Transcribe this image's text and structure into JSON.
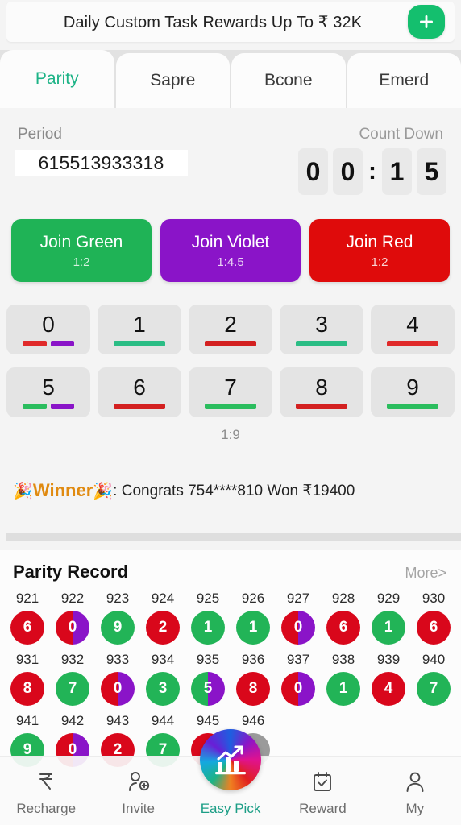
{
  "promo": {
    "text": "Daily Custom Task Rewards Up To ₹ 32K",
    "add_button_icon": "plus-icon"
  },
  "tabs": [
    {
      "label": "Parity",
      "active": true
    },
    {
      "label": "Sapre",
      "active": false
    },
    {
      "label": "Bcone",
      "active": false
    },
    {
      "label": "Emerd",
      "active": false
    }
  ],
  "game": {
    "period_label": "Period",
    "period_value": "615513933318",
    "countdown_label": "Count Down",
    "countdown": {
      "d1": "0",
      "d2": "0",
      "colon": ":",
      "d3": "1",
      "d4": "5"
    },
    "join_buttons": [
      {
        "title": "Join Green",
        "ratio": "1:2",
        "color": "#1fb356"
      },
      {
        "title": "Join Violet",
        "ratio": "1:4.5",
        "color": "#8a14c8"
      },
      {
        "title": "Join Red",
        "ratio": "1:2",
        "color": "#df0b0b"
      }
    ],
    "numbers_row1": [
      {
        "digit": "0",
        "colors": [
          "#e02a2a",
          "#8a14c8"
        ]
      },
      {
        "digit": "1",
        "colors": [
          "#2bbd85"
        ]
      },
      {
        "digit": "2",
        "colors": [
          "#d32020"
        ]
      },
      {
        "digit": "3",
        "colors": [
          "#2bbd85"
        ]
      },
      {
        "digit": "4",
        "colors": [
          "#e02a2a"
        ]
      }
    ],
    "numbers_row2": [
      {
        "digit": "5",
        "colors": [
          "#2bbd5e",
          "#8a14c8"
        ]
      },
      {
        "digit": "6",
        "colors": [
          "#d32020"
        ]
      },
      {
        "digit": "7",
        "colors": [
          "#2bbd5e"
        ]
      },
      {
        "digit": "8",
        "colors": [
          "#d32020"
        ]
      },
      {
        "digit": "9",
        "colors": [
          "#2bbd5e"
        ]
      }
    ],
    "number_ratio": "1:9"
  },
  "winner": {
    "emoji_left": "🎉",
    "word": "Winner",
    "emoji_right": "🎉",
    "message": ": Congrats 754****810 Won ₹19400"
  },
  "record": {
    "title": "Parity Record",
    "more_label": "More>",
    "rows": [
      [
        {
          "id": "921",
          "value": "6",
          "colors": [
            "#d9071b"
          ]
        },
        {
          "id": "922",
          "value": "0",
          "colors": [
            "#d9071b",
            "#8a14c8"
          ]
        },
        {
          "id": "923",
          "value": "9",
          "colors": [
            "#22b457"
          ]
        },
        {
          "id": "924",
          "value": "2",
          "colors": [
            "#d9071b"
          ]
        },
        {
          "id": "925",
          "value": "1",
          "colors": [
            "#22b457"
          ]
        },
        {
          "id": "926",
          "value": "1",
          "colors": [
            "#22b457"
          ]
        },
        {
          "id": "927",
          "value": "0",
          "colors": [
            "#d9071b",
            "#8a14c8"
          ]
        },
        {
          "id": "928",
          "value": "6",
          "colors": [
            "#d9071b"
          ]
        },
        {
          "id": "929",
          "value": "1",
          "colors": [
            "#22b457"
          ]
        },
        {
          "id": "930",
          "value": "6",
          "colors": [
            "#d9071b"
          ]
        }
      ],
      [
        {
          "id": "931",
          "value": "8",
          "colors": [
            "#d9071b"
          ]
        },
        {
          "id": "932",
          "value": "7",
          "colors": [
            "#22b457"
          ]
        },
        {
          "id": "933",
          "value": "0",
          "colors": [
            "#d9071b",
            "#8a14c8"
          ]
        },
        {
          "id": "934",
          "value": "3",
          "colors": [
            "#22b457"
          ]
        },
        {
          "id": "935",
          "value": "5",
          "colors": [
            "#22b457",
            "#8a14c8"
          ]
        },
        {
          "id": "936",
          "value": "8",
          "colors": [
            "#d9071b"
          ]
        },
        {
          "id": "937",
          "value": "0",
          "colors": [
            "#d9071b",
            "#8a14c8"
          ]
        },
        {
          "id": "938",
          "value": "1",
          "colors": [
            "#22b457"
          ]
        },
        {
          "id": "939",
          "value": "4",
          "colors": [
            "#d9071b"
          ]
        },
        {
          "id": "940",
          "value": "7",
          "colors": [
            "#22b457"
          ]
        }
      ],
      [
        {
          "id": "941",
          "value": "9",
          "colors": [
            "#22b457"
          ]
        },
        {
          "id": "942",
          "value": "0",
          "colors": [
            "#d9071b",
            "#8a14c8"
          ]
        },
        {
          "id": "943",
          "value": "2",
          "colors": [
            "#d9071b"
          ]
        },
        {
          "id": "944",
          "value": "7",
          "colors": [
            "#22b457"
          ]
        },
        {
          "id": "945",
          "value": "",
          "colors": [
            "#d9071b"
          ]
        },
        {
          "id": "946",
          "value": "",
          "colors": [
            "#9a9a9a"
          ]
        }
      ]
    ]
  },
  "bottom_nav": [
    {
      "label": "Recharge",
      "icon": "rupee-icon",
      "active": false
    },
    {
      "label": "Invite",
      "icon": "add-person-icon",
      "active": false
    },
    {
      "label": "Easy Pick",
      "icon": "chart-growth-icon",
      "active": true
    },
    {
      "label": "Reward",
      "icon": "calendar-check-icon",
      "active": false
    },
    {
      "label": "My",
      "icon": "person-icon",
      "active": false
    }
  ]
}
